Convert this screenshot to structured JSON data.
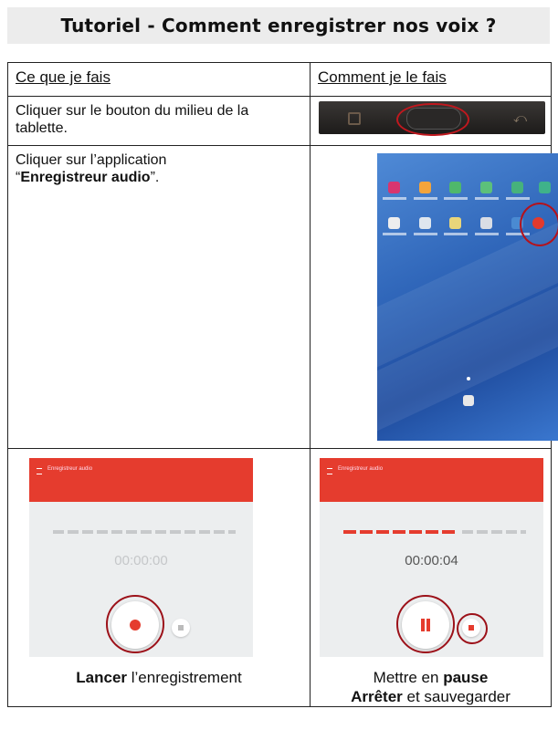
{
  "title": "Tutoriel - Comment enregistrer nos voix ?",
  "table": {
    "col1_header": "Ce que je fais",
    "col2_header": "Comment je le fais",
    "rows": [
      {
        "text": "Cliquer sur le bouton du milieu de la tablette."
      },
      {
        "text_prefix": "Cliquer sur l’application",
        "text_quote_open": "“",
        "text_bold": "Enregistreur audio",
        "text_suffix": "”."
      }
    ]
  },
  "recorder_left": {
    "app_title": "Enregistreur audio",
    "timer": "00:00:00",
    "caption_bold": "Lancer",
    "caption_rest": " l’enregistrement"
  },
  "recorder_right": {
    "app_title": "Enregistreur audio",
    "timer": "00:00:04",
    "caption_line1_a": "Mettre en ",
    "caption_line1_bold": "pause",
    "caption_line2_bold": "Arrêter",
    "caption_line2_rest": " et sauvegarder"
  },
  "colors": {
    "accent_red": "#e53c2e",
    "circle_red": "#b5121b"
  }
}
